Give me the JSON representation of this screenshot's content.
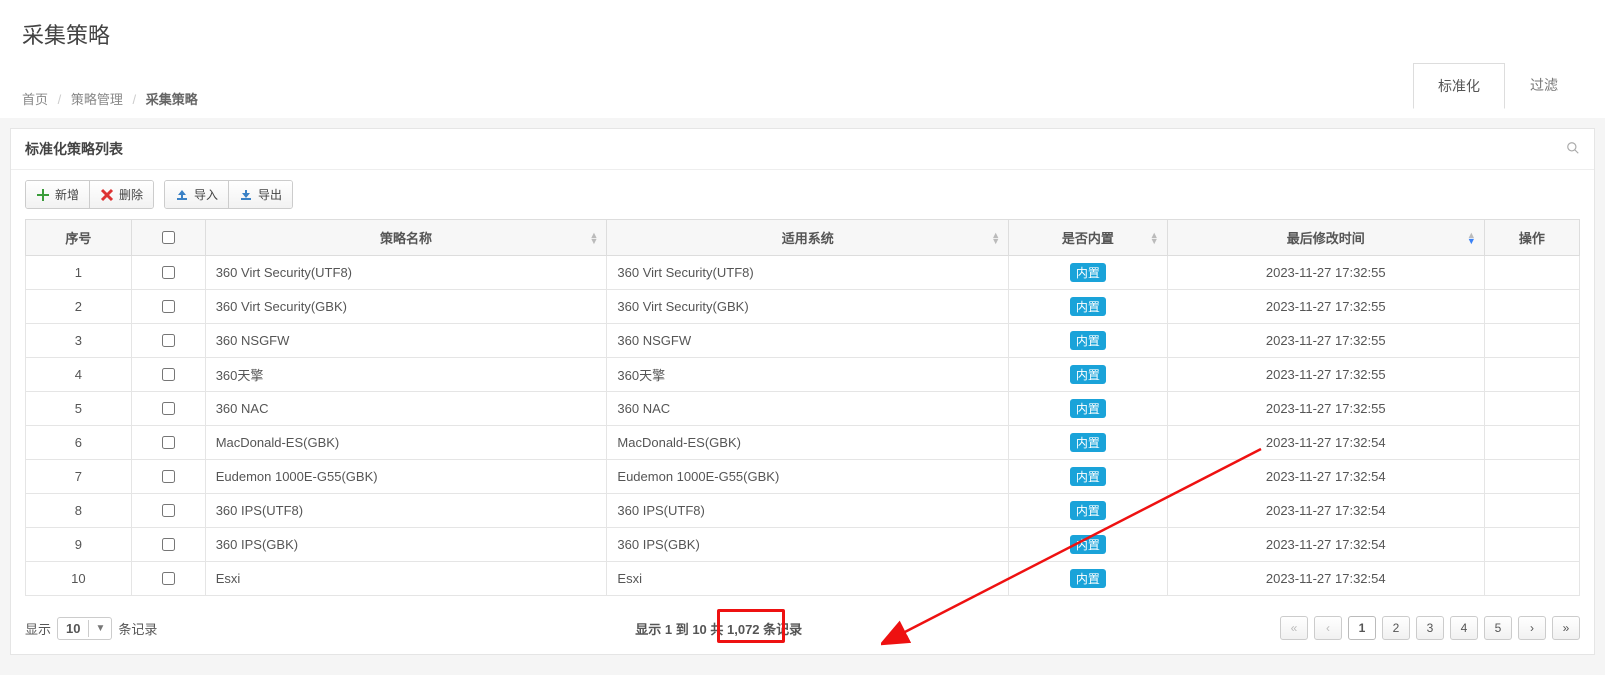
{
  "header": {
    "title": "采集策略",
    "breadcrumb": {
      "home": "首页",
      "mid": "策略管理",
      "current": "采集策略"
    },
    "tabs": {
      "normalize": "标准化",
      "filter": "过滤"
    }
  },
  "panel": {
    "title": "标准化策略列表"
  },
  "toolbar": {
    "add": "新增",
    "delete": "删除",
    "import": "导入",
    "export": "导出"
  },
  "table": {
    "columns": {
      "seq": "序号",
      "name": "策略名称",
      "system": "适用系统",
      "builtin": "是否内置",
      "mtime": "最后修改时间",
      "action": "操作"
    },
    "builtin_badge": "内置",
    "rows": [
      {
        "seq": "1",
        "name": "360 Virt Security(UTF8)",
        "system": "360 Virt Security(UTF8)",
        "mtime": "2023-11-27 17:32:55"
      },
      {
        "seq": "2",
        "name": "360 Virt Security(GBK)",
        "system": "360 Virt Security(GBK)",
        "mtime": "2023-11-27 17:32:55"
      },
      {
        "seq": "3",
        "name": "360 NSGFW",
        "system": "360 NSGFW",
        "mtime": "2023-11-27 17:32:55"
      },
      {
        "seq": "4",
        "name": "360天擎",
        "system": "360天擎",
        "mtime": "2023-11-27 17:32:55"
      },
      {
        "seq": "5",
        "name": "360 NAC",
        "system": "360 NAC",
        "mtime": "2023-11-27 17:32:55"
      },
      {
        "seq": "6",
        "name": "MacDonald-ES(GBK)",
        "system": "MacDonald-ES(GBK)",
        "mtime": "2023-11-27 17:32:54"
      },
      {
        "seq": "7",
        "name": "Eudemon 1000E-G55(GBK)",
        "system": "Eudemon 1000E-G55(GBK)",
        "mtime": "2023-11-27 17:32:54"
      },
      {
        "seq": "8",
        "name": "360 IPS(UTF8)",
        "system": "360 IPS(UTF8)",
        "mtime": "2023-11-27 17:32:54"
      },
      {
        "seq": "9",
        "name": "360 IPS(GBK)",
        "system": "360 IPS(GBK)",
        "mtime": "2023-11-27 17:32:54"
      },
      {
        "seq": "10",
        "name": "Esxi",
        "system": "Esxi",
        "mtime": "2023-11-27 17:32:54"
      }
    ]
  },
  "footer": {
    "show_prefix": "显示",
    "page_size": "10",
    "show_suffix": "条记录",
    "info": "显示 1 到 10 共 1,072 条记录",
    "pages": [
      "1",
      "2",
      "3",
      "4",
      "5"
    ]
  }
}
